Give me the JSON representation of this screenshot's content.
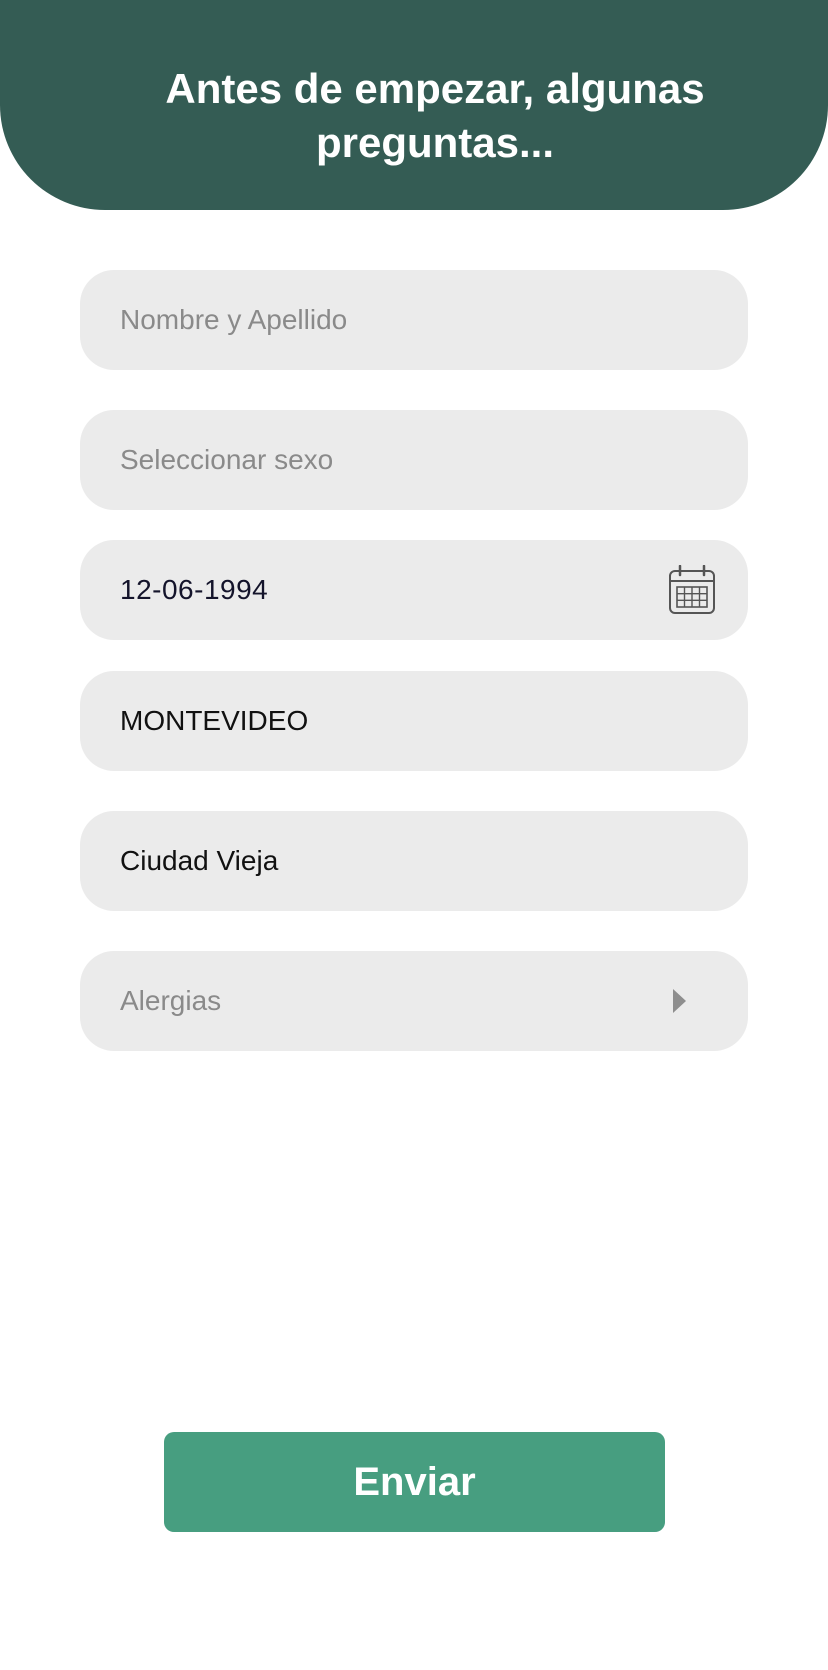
{
  "header": {
    "title": "Antes de empezar, algunas preguntas..."
  },
  "form": {
    "name_placeholder": "Nombre y Apellido",
    "sex_placeholder": "Seleccionar sexo",
    "birthdate_value": "12-06-1994",
    "department_value": "MONTEVIDEO",
    "neighborhood_value": "Ciudad Vieja",
    "allergies_placeholder": "Alergias"
  },
  "icons": {
    "calendar": "calendar-icon",
    "caret": "caret-right-icon"
  },
  "actions": {
    "submit_label": "Enviar"
  },
  "colors": {
    "header_bg": "#345c54",
    "field_bg": "#ebebeb",
    "button_bg": "#479e80",
    "placeholder": "#8a8a8a"
  }
}
